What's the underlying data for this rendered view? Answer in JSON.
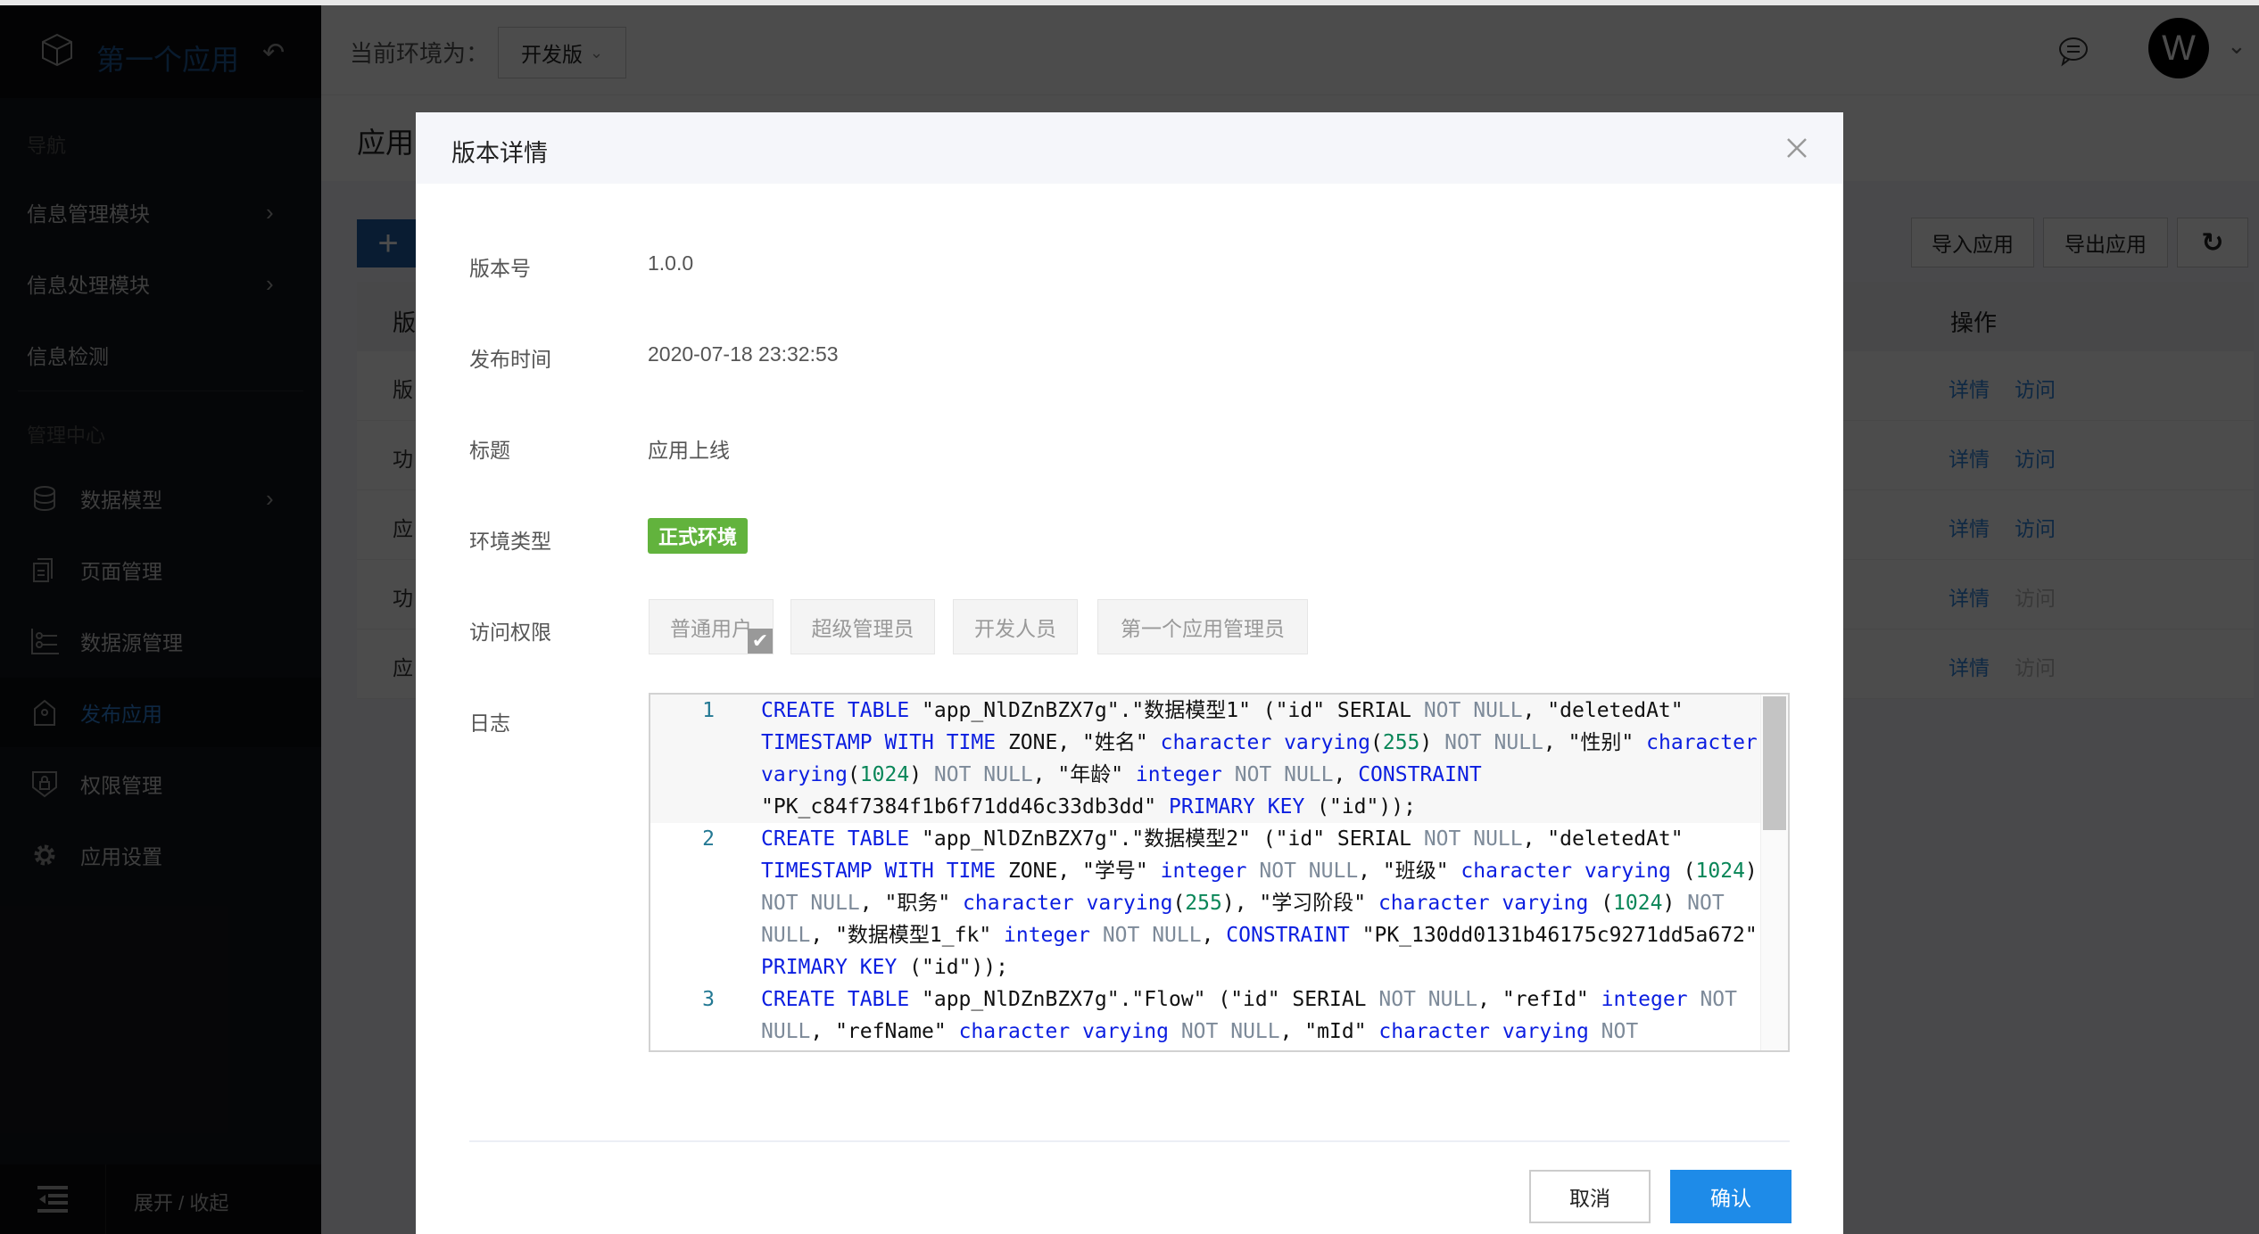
{
  "sidebar": {
    "app_name": "第一个应用",
    "section_nav": "导航",
    "section_admin": "管理中心",
    "nav_items": [
      {
        "label": "信息管理模块",
        "has_children": true
      },
      {
        "label": "信息处理模块",
        "has_children": true
      },
      {
        "label": "信息检测",
        "has_children": false
      }
    ],
    "admin_items": [
      {
        "label": "数据模型",
        "icon": "database-icon",
        "has_children": true
      },
      {
        "label": "页面管理",
        "icon": "pages-icon",
        "has_children": false
      },
      {
        "label": "数据源管理",
        "icon": "datasource-icon",
        "has_children": false
      },
      {
        "label": "发布应用",
        "icon": "publish-tag-icon",
        "active": true
      },
      {
        "label": "权限管理",
        "icon": "shield-lock-icon",
        "has_children": false
      },
      {
        "label": "应用设置",
        "icon": "gear-icon",
        "has_children": false
      }
    ],
    "footer_toggle": "展开 / 收起"
  },
  "topbar": {
    "env_label": "当前环境为：",
    "env_selected": "开发版",
    "avatar_initial": "W"
  },
  "page": {
    "title": "应用",
    "add_label": "+",
    "import_label": "导入应用",
    "export_label": "导出应用",
    "table": {
      "first_col_header": "版",
      "actions_header": "操作",
      "rows": [
        {
          "first_col": "版",
          "detail": "详情",
          "visit": "访问",
          "visit_enabled": true
        },
        {
          "first_col": "功",
          "detail": "详情",
          "visit": "访问",
          "visit_enabled": true
        },
        {
          "first_col": "应",
          "detail": "详情",
          "visit": "访问",
          "visit_enabled": true
        },
        {
          "first_col": "功",
          "detail": "详情",
          "visit": "访问",
          "visit_enabled": false
        },
        {
          "first_col": "应",
          "detail": "详情",
          "visit": "访问",
          "visit_enabled": false
        }
      ]
    }
  },
  "modal": {
    "title": "版本详情",
    "fields": {
      "version_label": "版本号",
      "version_value": "1.0.0",
      "publish_time_label": "发布时间",
      "publish_time_value": "2020-07-18 23:32:53",
      "title_label": "标题",
      "title_value": "应用上线",
      "env_type_label": "环境类型",
      "env_type_value": "正式环境",
      "access_label": "访问权限",
      "log_label": "日志"
    },
    "access_roles": [
      {
        "label": "普通用户",
        "checked": true
      },
      {
        "label": "超级管理员",
        "checked": false
      },
      {
        "label": "开发人员",
        "checked": false
      },
      {
        "label": "第一个应用管理员",
        "checked": false
      }
    ],
    "log_lines": [
      {
        "num": "1",
        "tokens": [
          [
            "kw",
            "CREATE TABLE"
          ],
          [
            "t",
            " \"app_NlDZnBZX7g\".\"数据模型1\" (\"id\" SERIAL "
          ],
          [
            "nn",
            "NOT NULL"
          ],
          [
            "t",
            ", \"deletedAt\" "
          ],
          [
            "kw",
            "TIMESTAMP WITH TIME"
          ],
          [
            "t",
            " ZONE, \"姓名\" "
          ],
          [
            "kw",
            "character varying"
          ],
          [
            "t",
            "("
          ],
          [
            "num",
            "255"
          ],
          [
            "t",
            ") "
          ],
          [
            "nn",
            "NOT NULL"
          ],
          [
            "t",
            ", \"性别\" "
          ],
          [
            "kw",
            "character varying"
          ],
          [
            "t",
            "("
          ],
          [
            "num",
            "1024"
          ],
          [
            "t",
            ") "
          ],
          [
            "nn",
            "NOT NULL"
          ],
          [
            "t",
            ", \"年龄\" "
          ],
          [
            "kw",
            "integer"
          ],
          [
            "t",
            " "
          ],
          [
            "nn",
            "NOT NULL"
          ],
          [
            "t",
            ", "
          ],
          [
            "kw",
            "CONSTRAINT"
          ],
          [
            "t",
            " \"PK_c84f7384f1b6f71dd46c33db3dd\" "
          ],
          [
            "kw",
            "PRIMARY KEY"
          ],
          [
            "t",
            " (\"id\"));"
          ]
        ]
      },
      {
        "num": "2",
        "tokens": [
          [
            "kw",
            "CREATE TABLE"
          ],
          [
            "t",
            " \"app_NlDZnBZX7g\".\"数据模型2\" (\"id\" SERIAL "
          ],
          [
            "nn",
            "NOT NULL"
          ],
          [
            "t",
            ", \"deletedAt\" "
          ],
          [
            "kw",
            "TIMESTAMP WITH TIME"
          ],
          [
            "t",
            " ZONE, \"学号\" "
          ],
          [
            "kw",
            "integer"
          ],
          [
            "t",
            " "
          ],
          [
            "nn",
            "NOT NULL"
          ],
          [
            "t",
            ", \"班级\" "
          ],
          [
            "kw",
            "character varying"
          ],
          [
            "t",
            " ("
          ],
          [
            "num",
            "1024"
          ],
          [
            "t",
            ") "
          ],
          [
            "nn",
            "NOT NULL"
          ],
          [
            "t",
            ", \"职务\" "
          ],
          [
            "kw",
            "character varying"
          ],
          [
            "t",
            "("
          ],
          [
            "num",
            "255"
          ],
          [
            "t",
            "), \"学习阶段\" "
          ],
          [
            "kw",
            "character varying"
          ],
          [
            "t",
            " ("
          ],
          [
            "num",
            "1024"
          ],
          [
            "t",
            ") "
          ],
          [
            "nn",
            "NOT NULL"
          ],
          [
            "t",
            ", \"数据模型1_fk\" "
          ],
          [
            "kw",
            "integer"
          ],
          [
            "t",
            " "
          ],
          [
            "nn",
            "NOT NULL"
          ],
          [
            "t",
            ", "
          ],
          [
            "kw",
            "CONSTRAINT"
          ],
          [
            "t",
            " \"PK_130dd0131b46175c9271dd5a672\" "
          ],
          [
            "kw",
            "PRIMARY KEY"
          ],
          [
            "t",
            " (\"id\"));"
          ]
        ]
      },
      {
        "num": "3",
        "tokens": [
          [
            "kw",
            "CREATE TABLE"
          ],
          [
            "t",
            " \"app_NlDZnBZX7g\".\"Flow\" (\"id\" SERIAL "
          ],
          [
            "nn",
            "NOT NULL"
          ],
          [
            "t",
            ", \"refId\" "
          ],
          [
            "kw",
            "integer"
          ],
          [
            "t",
            " "
          ],
          [
            "nn",
            "NOT NULL"
          ],
          [
            "t",
            ", \"refName\" "
          ],
          [
            "kw",
            "character varying"
          ],
          [
            "t",
            " "
          ],
          [
            "nn",
            "NOT NULL"
          ],
          [
            "t",
            ", \"mId\" "
          ],
          [
            "kw",
            "character varying"
          ],
          [
            "t",
            " "
          ],
          [
            "nn",
            "NOT"
          ]
        ]
      }
    ],
    "cancel_label": "取消",
    "confirm_label": "确认"
  },
  "colors": {
    "primary": "#1e8be8",
    "sidebar_active": "#2f86e0",
    "env_tag": "#62b33d"
  }
}
